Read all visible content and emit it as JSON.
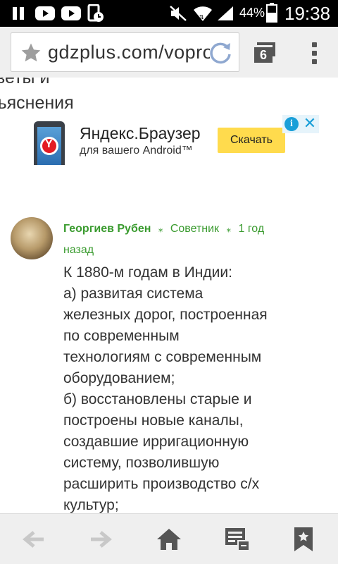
{
  "status_bar": {
    "battery_percent": "44%",
    "time": "19:38"
  },
  "browser": {
    "url": "gdzplus.com/vopros",
    "tab_count": "6"
  },
  "page": {
    "partial_heading_line1": "веты и",
    "partial_heading_line2": "ъяснения",
    "ad": {
      "title": "Яндекс.Браузер",
      "subtitle": "для вашего Android™",
      "button_label": "Скачать",
      "info_icon": "i",
      "close_icon": "✕"
    },
    "answer": {
      "author": "Георгиев Рубен",
      "separator": "⁎",
      "rank": "Советник",
      "time_part1": "1 год",
      "time_part2": "назад",
      "lines": [
        "К 1880-м годам в Индии:",
        "а) развитая система",
        "железных дорог, построенная",
        "по современным",
        "технологиям с современным",
        "оборудованием;",
        "б) восстановлены старые и",
        "построены новые каналы,",
        "создавшие ирригационную",
        "систему, позволившую",
        "расширить производство с/х",
        "культур;"
      ]
    }
  }
}
